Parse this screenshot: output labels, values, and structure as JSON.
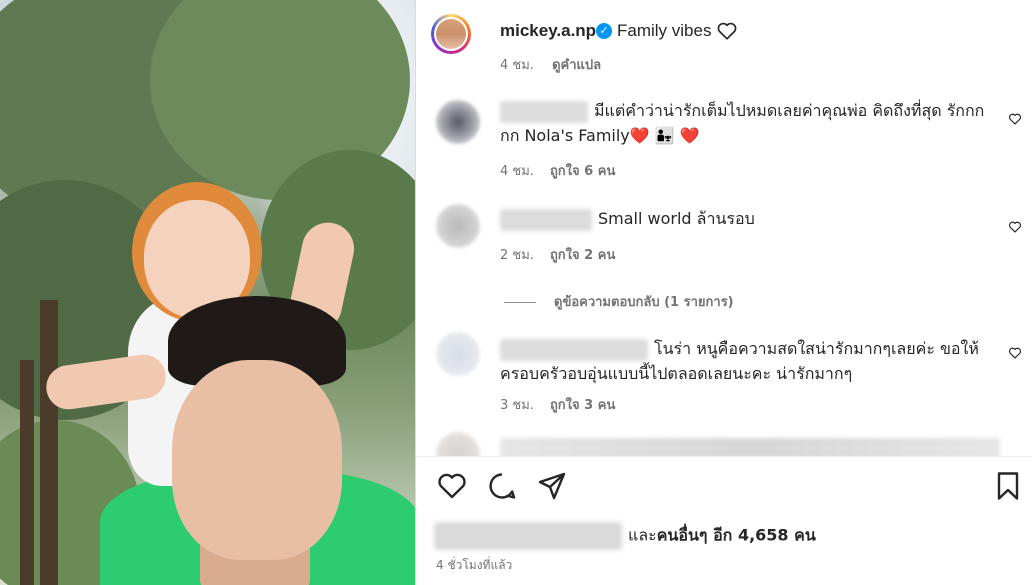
{
  "post": {
    "username": "mickey.a.np",
    "caption": "Family vibes",
    "time": "4 ชม.",
    "translate": "ดูคำแปล"
  },
  "comments": [
    {
      "text": "มีแต่คำว่าน่ารักเต็มไปหมดเลยค่าคุณพ่อ คิดถึงที่สุด รักกกกก Nola's Family❤️ 👨‍👧 ❤️",
      "time": "4 ชม.",
      "likes": "ถูกใจ 6 คน"
    },
    {
      "text": "Small world ล้านรอบ",
      "time": "2 ชม.",
      "likes": "ถูกใจ 2 คน"
    },
    {
      "text": "โนร่า หนูคือความสดใสน่ารักมากๆเลยค่ะ ขอให้ครอบครัวอบอุ่นแบบนี้ไปตลอดเลยนะคะ น่ารักมากๆ",
      "time": "3 ชม.",
      "likes": "ถูกใจ 3 คน"
    }
  ],
  "view_replies": "ดูข้อความตอบกลับ (1 รายการ)",
  "likes": {
    "prefix": "และ",
    "text": "คนอื่นๆ อีก 4,658 คน"
  },
  "posted_ago": "4 ชั่วโมงที่แล้ว",
  "icons": {
    "verified": "verified-badge-icon",
    "heart": "heart-icon",
    "comment": "comment-icon",
    "share": "share-icon",
    "save": "bookmark-icon"
  },
  "colors": {
    "accent": "#0095f6",
    "muted": "#737373",
    "text": "#262626"
  }
}
